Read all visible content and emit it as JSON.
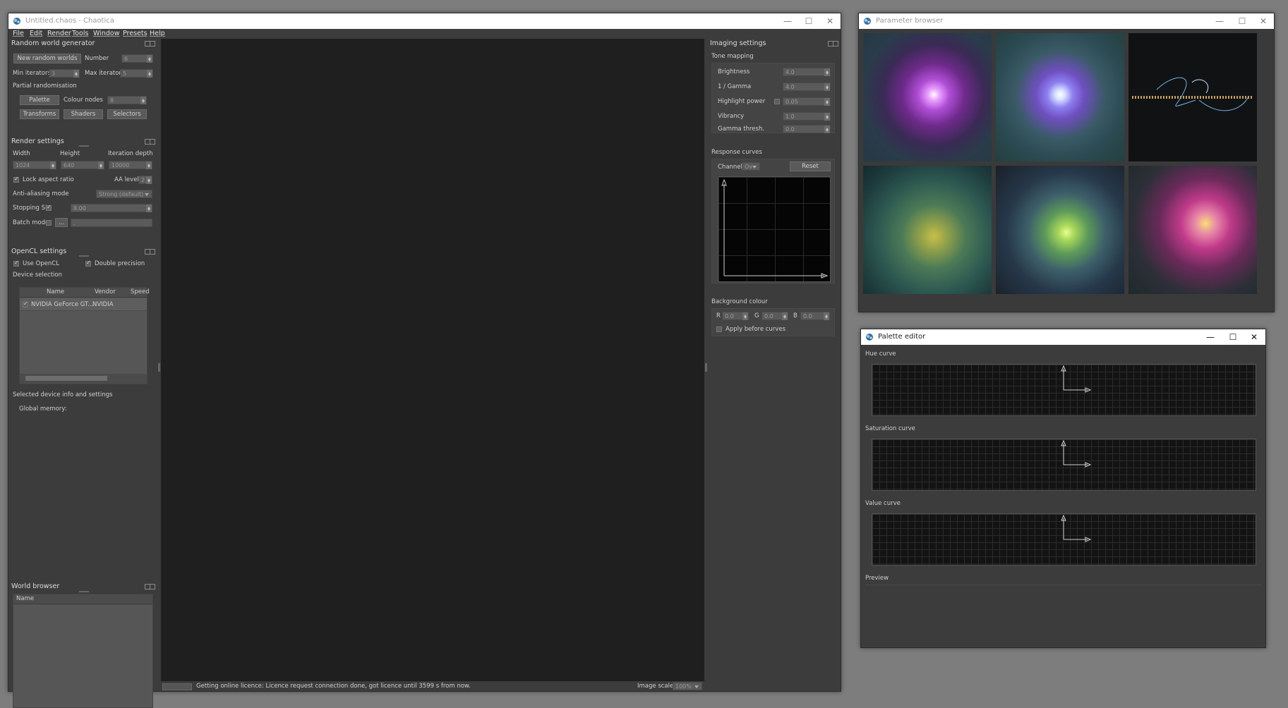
{
  "main_window": {
    "title": "Untitled.chaos - Chaotica",
    "menu": [
      "File",
      "Edit",
      "Render",
      "Tools",
      "Window",
      "Presets",
      "Help"
    ]
  },
  "random_world": {
    "header": "Random world generator",
    "new_button": "New random worlds",
    "number_label": "Number",
    "number_value": "6",
    "min_iter_label": "Min iterators",
    "min_iter_value": "3",
    "max_iter_label": "Max iterators",
    "max_iter_value": "5",
    "partial_label": "Partial randomisation",
    "palette_button": "Palette",
    "colour_nodes_label": "Colour nodes",
    "colour_nodes_value": "8",
    "transforms_button": "Transforms",
    "shaders_button": "Shaders",
    "selectors_button": "Selectors"
  },
  "render_settings": {
    "header": "Render settings",
    "width_label": "Width",
    "height_label": "Height",
    "depth_label": "Iteration depth",
    "width_value": "1024",
    "height_value": "640",
    "depth_value": "10000",
    "lock_aspect_label": "Lock aspect ratio",
    "aa_level_label": "AA level",
    "aa_level_value": "2",
    "aa_mode_label": "Anti-aliasing mode",
    "aa_mode_value": "Strong (default)",
    "stopping_label": "Stopping SL",
    "stopping_value": "8.00",
    "batch_label": "Batch mode",
    "batch_browse": "...",
    "batch_value": "."
  },
  "opencl": {
    "header": "OpenCL settings",
    "use_opencl": "Use OpenCL",
    "double_precision": "Double precision",
    "device_selection": "Device selection",
    "col_name": "Name",
    "col_vendor": "Vendor",
    "col_speed": "Speed",
    "device_name": "NVIDIA GeForce GT...",
    "device_vendor": "NVIDIA",
    "device_info": "Selected device info and settings",
    "global_memory": "Global memory:"
  },
  "world_browser": {
    "header": "World browser",
    "col_name": "Name"
  },
  "status": {
    "message": "Getting online licence: Licence request connection done, got licence until 3599 s from now.",
    "scale_label": "Image scale:",
    "scale_value": "100%"
  },
  "imaging": {
    "header": "Imaging settings",
    "tone_mapping": "Tone mapping",
    "brightness_label": "Brightness",
    "brightness_value": "4.0",
    "gamma_label": "1 / Gamma",
    "gamma_value": "4.0",
    "highlight_label": "Highlight power",
    "highlight_value": "0.05",
    "vibrancy_label": "Vibrancy",
    "vibrancy_value": "1.0",
    "gamma_thresh_label": "Gamma thresh.",
    "gamma_thresh_value": "0.0",
    "response_curves": "Response curves",
    "channel_label": "Channel:",
    "channel_value": "Ov",
    "reset_button": "Reset",
    "bg_colour": "Background colour",
    "r_label": "R",
    "r_value": "0.0",
    "g_label": "G",
    "g_value": "0.0",
    "b_label": "B",
    "b_value": "0.0",
    "apply_before": "Apply before curves"
  },
  "parameter_browser": {
    "title": "Parameter browser"
  },
  "palette_editor": {
    "title": "Palette editor",
    "hue_curve": "Hue curve",
    "saturation_curve": "Saturation curve",
    "value_curve": "Value curve",
    "preview": "Preview"
  },
  "colors": {
    "window_bg": "#3c3c3c",
    "canvas_bg": "#1f1f1f",
    "desktop": "#7d7d7d"
  }
}
